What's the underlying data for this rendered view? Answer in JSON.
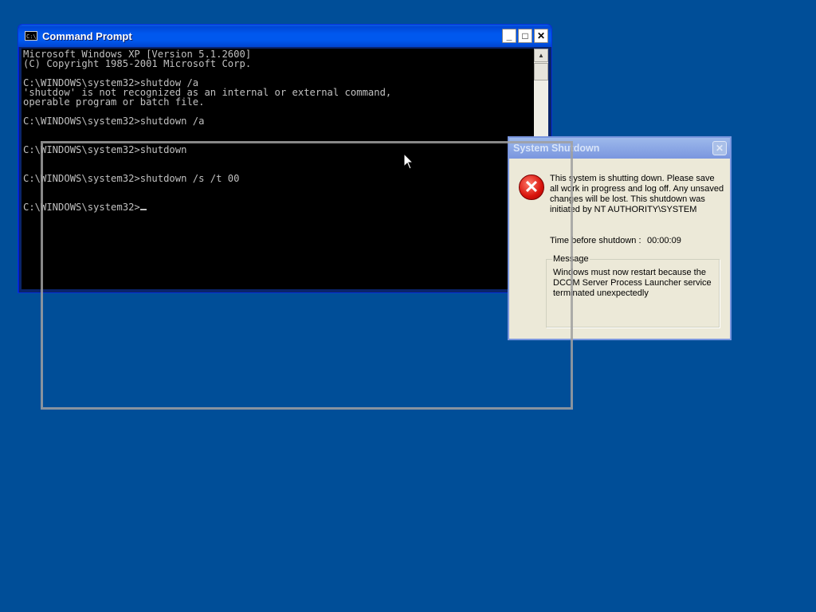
{
  "cmd": {
    "title": "Command Prompt",
    "icon_text": "C:\\",
    "lines": [
      "Microsoft Windows XP [Version 5.1.2600]",
      "(C) Copyright 1985-2001 Microsoft Corp.",
      "",
      "C:\\WINDOWS\\system32>shutdow /a",
      "'shutdow' is not recognized as an internal or external command,",
      "operable program or batch file.",
      "",
      "C:\\WINDOWS\\system32>shutdown /a",
      "",
      "",
      "C:\\WINDOWS\\system32>shutdown",
      "",
      "",
      "C:\\WINDOWS\\system32>shutdown /s /t 00",
      "",
      "",
      "C:\\WINDOWS\\system32>"
    ],
    "minimize": "_",
    "maximize": "□",
    "close": "✕"
  },
  "dialog": {
    "title": "System Shutdown",
    "close": "✕",
    "message": "This system is shutting down. Please save all work in progress and log off. Any unsaved changes will be lost. This shutdown was initiated by NT AUTHORITY\\SYSTEM",
    "time_label": "Time before shutdown :",
    "time_value": "00:00:09",
    "group_label": "Message",
    "reason": "Windows must now restart because the DCOM Server Process Launcher service terminated unexpectedly"
  },
  "colors": {
    "desktop": "#004e98",
    "console_bg": "#000000",
    "console_text": "#c0c0c0"
  },
  "icons": {
    "console": "console-icon",
    "error": "error-icon",
    "pointer": "mouse-pointer-icon"
  }
}
